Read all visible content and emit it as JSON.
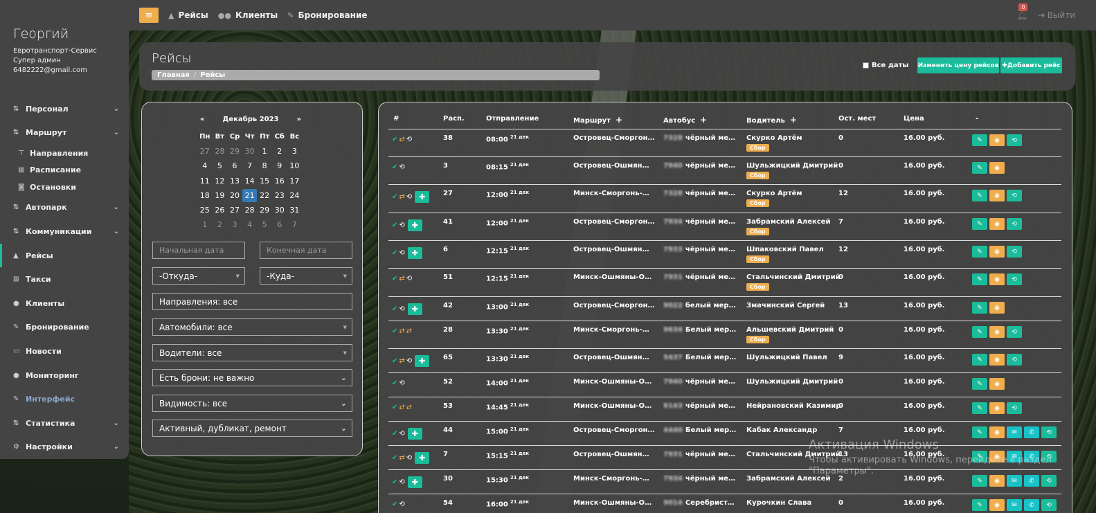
{
  "topbar": {
    "links": [
      {
        "icon": "road-icon",
        "label": "Рейсы"
      },
      {
        "icon": "users-icon",
        "label": "Клиенты"
      },
      {
        "icon": "edit-icon",
        "label": "Бронирование"
      }
    ],
    "notifications_count": "0",
    "logout_label": "Выйти"
  },
  "sidebar": {
    "user_name": "Георгий",
    "company": "Евротранспорт-Сервис",
    "role": "Супер админ",
    "email": "6482222@gmail.com",
    "items": [
      {
        "label": "Персонал",
        "icon": "sort-icon"
      },
      {
        "label": "Маршрут",
        "icon": "sort-icon"
      },
      {
        "label": "Направления",
        "icon": "signpost-icon"
      },
      {
        "label": "Расписание",
        "icon": "calendar-icon"
      },
      {
        "label": "Остановки",
        "icon": "bus-icon"
      },
      {
        "label": "Автопарк",
        "icon": "sort-icon"
      },
      {
        "label": "Коммуникации",
        "icon": "sort-icon"
      },
      {
        "label": "Рейсы",
        "icon": "road-icon"
      },
      {
        "label": "Такси",
        "icon": "car-icon"
      },
      {
        "label": "Клиенты",
        "icon": "users-icon"
      },
      {
        "label": "Бронирование",
        "icon": "edit-icon"
      },
      {
        "label": "Новости",
        "icon": "newspaper-icon"
      },
      {
        "label": "Мониторинг",
        "icon": "map-marker-icon"
      },
      {
        "label": "Интерфейс",
        "icon": "edit-icon"
      },
      {
        "label": "Статистика",
        "icon": "sort-icon"
      },
      {
        "label": "Настройки",
        "icon": "gear-icon"
      }
    ]
  },
  "header": {
    "title": "Рейсы",
    "breadcrumb_home": "Главная",
    "breadcrumb_current": "Рейсы",
    "all_dates_label": "Все даты",
    "change_price_label": "Изменить цену рейсов",
    "add_trip_label": "Добавить рейс"
  },
  "calendar": {
    "month": "Декабрь 2023",
    "prev": "«",
    "next": "»",
    "weekdays": [
      "Пн",
      "Вт",
      "Ср",
      "Чт",
      "Пт",
      "Сб",
      "Вс"
    ],
    "weeks": [
      [
        "27",
        "28",
        "29",
        "30",
        "1",
        "2",
        "3"
      ],
      [
        "4",
        "5",
        "6",
        "7",
        "8",
        "9",
        "10"
      ],
      [
        "11",
        "12",
        "13",
        "14",
        "15",
        "16",
        "17"
      ],
      [
        "18",
        "19",
        "20",
        "21",
        "22",
        "23",
        "24"
      ],
      [
        "25",
        "26",
        "27",
        "28",
        "29",
        "30",
        "31"
      ],
      [
        "1",
        "2",
        "3",
        "4",
        "5",
        "6",
        "7"
      ]
    ],
    "selected": "21"
  },
  "filters": {
    "start_date_placeholder": "Начальная дата",
    "end_date_placeholder": "Конечная дата",
    "from": "-Откуда-",
    "to": "-Куда-",
    "directions": "Направления: все",
    "cars": "Автомобили: все",
    "drivers": "Водители: все",
    "bookings": "Есть брони: не важно",
    "visibility": "Видимость: все",
    "status": "Активный, дубликат, ремонт"
  },
  "table": {
    "headers": [
      "#",
      "Расп.",
      "Отправление",
      "Маршрут",
      "Автобус",
      "Водитель",
      "Ост. мест",
      "Цена",
      "-"
    ],
    "sbor_label": "Сбор",
    "rows": [
      {
        "icons": [
          "ok",
          "swap",
          "bus"
        ],
        "plus": false,
        "sched": "38",
        "time": "08:00",
        "date": "21 дек",
        "route": "Островец-Сморгонь-М...",
        "plate": "7328",
        "bus": "чёрный мерсе...",
        "driver": "Скурко Артём",
        "sbor": true,
        "seats": "0",
        "price": "16.00 руб.",
        "acts": [
          "g",
          "o",
          "g"
        ]
      },
      {
        "icons": [
          "ok",
          "bus"
        ],
        "plus": false,
        "sched": "3",
        "time": "08:15",
        "date": "21 дек",
        "route": "Островец-Ошмяны-М...",
        "plate": "7940",
        "bus": "чёрный мерсе...",
        "driver": "Шульжицкий Дмитрий",
        "sbor": true,
        "seats": "0",
        "price": "16.00 руб.",
        "acts": [
          "g",
          "o"
        ]
      },
      {
        "icons": [
          "ok",
          "swap",
          "bus"
        ],
        "plus": true,
        "sched": "27",
        "time": "12:00",
        "date": "21 дек",
        "route": "Минск-Сморгонь-Остр...",
        "plate": "7328",
        "bus": "чёрный мерсе...",
        "driver": "Скурко Артём",
        "sbor": true,
        "seats": "12",
        "price": "16.00 руб.",
        "acts": [
          "g",
          "o",
          "g"
        ]
      },
      {
        "icons": [
          "ok",
          "bus"
        ],
        "plus": true,
        "sched": "41",
        "time": "12:00",
        "date": "21 дек",
        "route": "Островец-Сморгонь-М...",
        "plate": "7934",
        "bus": "чёрный мерсе...",
        "driver": "Забрамский Алексей",
        "sbor": true,
        "seats": "7",
        "price": "16.00 руб.",
        "acts": [
          "g",
          "o",
          "g"
        ]
      },
      {
        "icons": [
          "ok",
          "bus"
        ],
        "plus": true,
        "sched": "6",
        "time": "12:15",
        "date": "21 дек",
        "route": "Островец-Ошмяны-М...",
        "plate": "7933",
        "bus": "чёрный мерсе...",
        "driver": "Шпаковский Павел",
        "sbor": true,
        "seats": "12",
        "price": "16.00 руб.",
        "acts": [
          "g",
          "o",
          "g"
        ]
      },
      {
        "icons": [
          "ok",
          "swap",
          "bus"
        ],
        "plus": false,
        "sched": "51",
        "time": "12:15",
        "date": "21 дек",
        "route": "Минск-Ошмяны-Остро...",
        "plate": "7931",
        "bus": "чёрный мерсе...",
        "driver": "Стальчинский Дмитрий",
        "sbor": true,
        "seats": "0",
        "price": "16.00 руб.",
        "acts": [
          "g",
          "o",
          "g"
        ]
      },
      {
        "icons": [
          "ok",
          "bus"
        ],
        "plus": true,
        "sched": "42",
        "time": "13:00",
        "date": "21 дек",
        "route": "Островец-Сморгонь-М...",
        "plate": "9022",
        "bus": "белый мерсед...",
        "driver": "Змачинский Сергей",
        "sbor": false,
        "seats": "13",
        "price": "16.00 руб.",
        "acts": [
          "g",
          "o"
        ]
      },
      {
        "icons": [
          "ok",
          "swap",
          "swap"
        ],
        "plus": false,
        "sched": "28",
        "time": "13:30",
        "date": "21 дек",
        "route": "Минск-Сморгонь-Остр...",
        "plate": "9634",
        "bus": "Белый мерседе...",
        "driver": "Альшевский Дмитрий",
        "sbor": true,
        "seats": "0",
        "price": "16.00 руб.",
        "acts": [
          "g",
          "o",
          "g"
        ]
      },
      {
        "icons": [
          "ok",
          "swap",
          "bus"
        ],
        "plus": true,
        "sched": "65",
        "time": "13:30",
        "date": "21 дек",
        "route": "Островец-Ошмяны-М...",
        "plate": "5437",
        "bus": "Белый мерсед...",
        "driver": "Шульжицкий Павел",
        "sbor": false,
        "seats": "9",
        "price": "16.00 руб.",
        "acts": [
          "g",
          "o",
          "g"
        ]
      },
      {
        "icons": [
          "ok",
          "bus"
        ],
        "plus": false,
        "sched": "52",
        "time": "14:00",
        "date": "21 дек",
        "route": "Минск-Ошмяны-Остро...",
        "plate": "7940",
        "bus": "чёрный мерсе...",
        "driver": "Шульжицкий Дмитрий",
        "sbor": false,
        "seats": "0",
        "price": "16.00 руб.",
        "acts": [
          "g",
          "o"
        ]
      },
      {
        "icons": [
          "ok",
          "swap",
          "swap"
        ],
        "plus": false,
        "sched": "53",
        "time": "14:45",
        "date": "21 дек",
        "route": "Минск-Ошмяны-Остро...",
        "plate": "6143",
        "bus": "чёрный мерсе...",
        "driver": "Нейрановский Казимир",
        "sbor": false,
        "seats": "0",
        "price": "16.00 руб.",
        "acts": [
          "g",
          "o",
          "g"
        ]
      },
      {
        "icons": [
          "ok",
          "bus"
        ],
        "plus": true,
        "sched": "44",
        "time": "15:00",
        "date": "21 дек",
        "route": "Островец-Сморгонь-М...",
        "plate": "4440",
        "bus": "Белый мерсед...",
        "driver": "Кабак Александр",
        "sbor": false,
        "seats": "7",
        "price": "16.00 руб.",
        "acts": [
          "g",
          "o",
          "c",
          "c",
          "g"
        ]
      },
      {
        "icons": [
          "ok",
          "swap",
          "bus"
        ],
        "plus": true,
        "sched": "7",
        "time": "15:15",
        "date": "21 дек",
        "route": "Островец-Ошмяны-М...",
        "plate": "7931",
        "bus": "чёрный мерсе...",
        "driver": "Стальчинский Дмитрий",
        "sbor": false,
        "seats": "13",
        "price": "16.00 руб.",
        "acts": [
          "g",
          "o",
          "c",
          "c",
          "g"
        ]
      },
      {
        "icons": [
          "ok",
          "bus"
        ],
        "plus": true,
        "sched": "30",
        "time": "15:30",
        "date": "21 дек",
        "route": "Минск-Сморгонь-Остр...",
        "plate": "7934",
        "bus": "чёрный мерсе...",
        "driver": "Забрамский Алексей",
        "sbor": false,
        "seats": "2",
        "price": "16.00 руб.",
        "acts": [
          "g",
          "o",
          "c",
          "c",
          "g"
        ]
      },
      {
        "icons": [
          "ok",
          "bus"
        ],
        "plus": false,
        "sched": "54",
        "time": "16:00",
        "date": "21 дек",
        "route": "Минск-Ошмяны-Остро...",
        "plate": "9014",
        "bus": "Серебристый ...",
        "driver": "Курочкин Слава",
        "sbor": false,
        "seats": "0",
        "price": "16.00 руб.",
        "acts": [
          "g",
          "o",
          "c",
          "c",
          "g"
        ]
      }
    ]
  },
  "watermark": {
    "line1": "Активация Windows",
    "line2": "Чтобы активировать Windows, перейдите в раздел",
    "line3": "\"Параметры\"."
  }
}
